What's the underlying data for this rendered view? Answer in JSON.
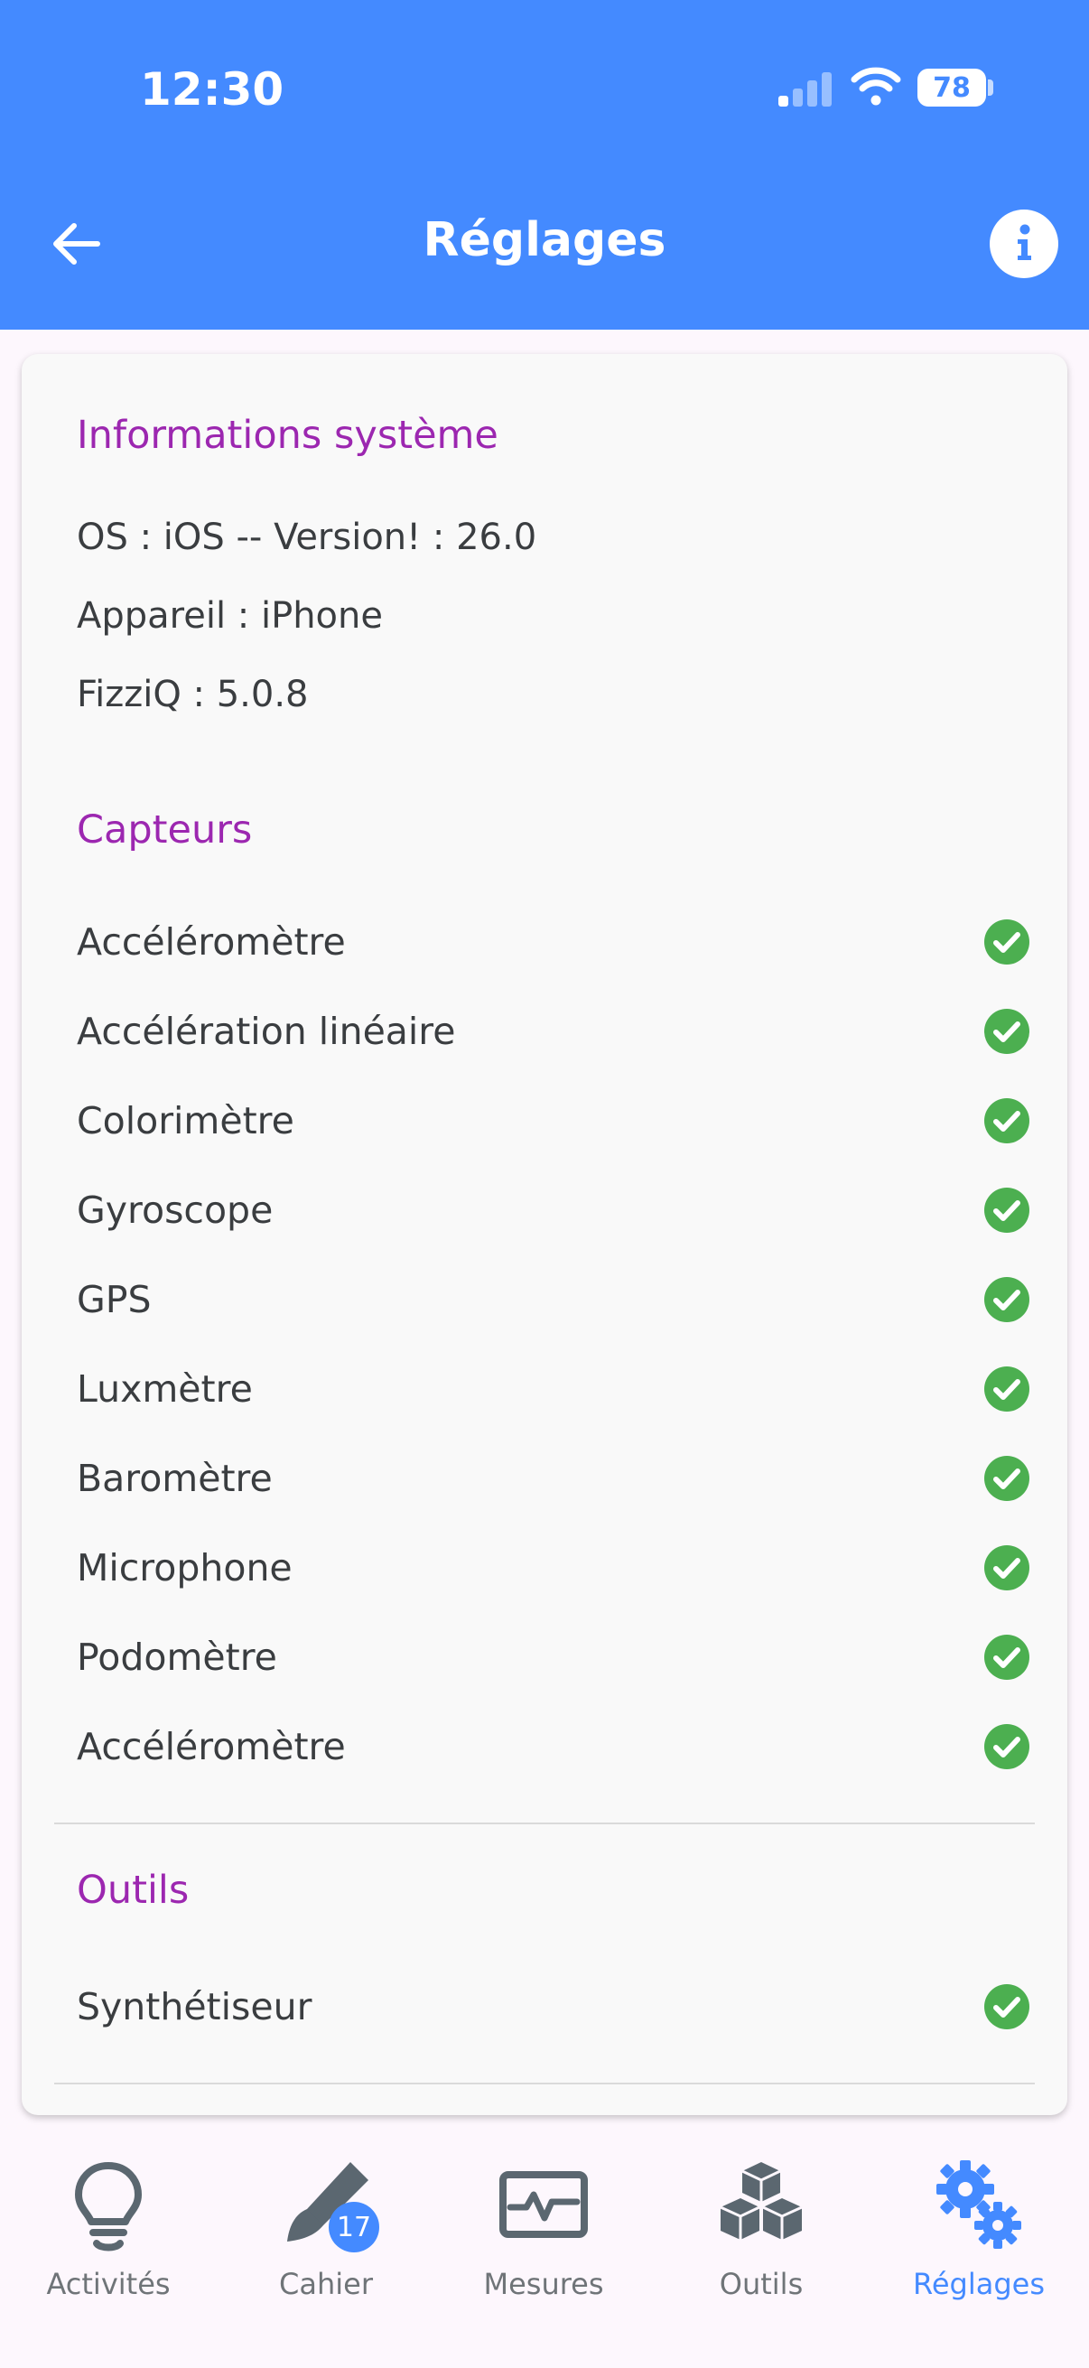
{
  "status_bar": {
    "time": "12:30",
    "battery": "78"
  },
  "header": {
    "title": "Réglages"
  },
  "system_info": {
    "title": "Informations système",
    "os": "OS : iOS -- Version! : 26.0",
    "device": "Appareil : iPhone",
    "app_version": "FizziQ  : 5.0.8"
  },
  "sensors": {
    "title": "Capteurs",
    "items": [
      {
        "label": "Accéléromètre"
      },
      {
        "label": "Accélération linéaire"
      },
      {
        "label": "Colorimètre"
      },
      {
        "label": "Gyroscope"
      },
      {
        "label": "GPS"
      },
      {
        "label": "Luxmètre"
      },
      {
        "label": "Baromètre"
      },
      {
        "label": "Microphone"
      },
      {
        "label": "Podomètre"
      },
      {
        "label": "Accéléromètre"
      }
    ]
  },
  "tools": {
    "title": "Outils",
    "items": [
      {
        "label": "Synthétiseur"
      }
    ]
  },
  "bottom_nav": {
    "items": [
      {
        "label": "Activités",
        "icon": "lightbulb-icon"
      },
      {
        "label": "Cahier",
        "icon": "pen-icon",
        "badge": "17"
      },
      {
        "label": "Mesures",
        "icon": "waveform-icon"
      },
      {
        "label": "Outils",
        "icon": "cubes-icon"
      },
      {
        "label": "Réglages",
        "icon": "gears-icon",
        "active": true
      }
    ]
  },
  "colors": {
    "primary": "#448aff",
    "section": "#9c27b0",
    "check": "#4caf50",
    "nav_inactive": "#6f7478"
  }
}
